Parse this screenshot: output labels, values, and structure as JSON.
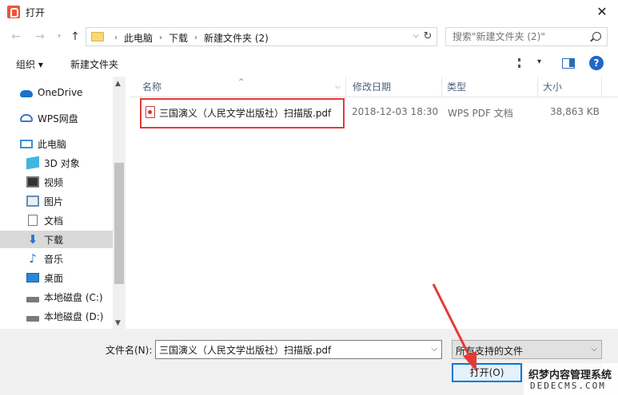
{
  "window": {
    "title": "打开",
    "close_glyph": "✕"
  },
  "address": {
    "crumbs": [
      "此电脑",
      "下载",
      "新建文件夹 (2)"
    ],
    "search_placeholder": "搜索\"新建文件夹 (2)\""
  },
  "toolbar": {
    "organize": "组织 ▾",
    "new_folder": "新建文件夹"
  },
  "nav": {
    "items": [
      {
        "label": "OneDrive",
        "icon": "cloud-icon"
      },
      {
        "label": "WPS网盘",
        "icon": "wps-cloud-icon"
      },
      {
        "label": "此电脑",
        "icon": "computer-icon"
      },
      {
        "label": "3D 对象",
        "icon": "3d-objects-icon"
      },
      {
        "label": "视频",
        "icon": "video-icon"
      },
      {
        "label": "图片",
        "icon": "pictures-icon"
      },
      {
        "label": "文档",
        "icon": "documents-icon"
      },
      {
        "label": "下载",
        "icon": "download-icon",
        "selected": true
      },
      {
        "label": "音乐",
        "icon": "music-icon"
      },
      {
        "label": "桌面",
        "icon": "desktop-icon"
      },
      {
        "label": "本地磁盘 (C:)",
        "icon": "drive-icon"
      },
      {
        "label": "本地磁盘 (D:)",
        "icon": "drive-icon"
      }
    ]
  },
  "columns": {
    "name": "名称",
    "date": "修改日期",
    "type": "类型",
    "size": "大小"
  },
  "files": [
    {
      "name": "三国演义（人民文学出版社）扫描版.pdf",
      "date": "2018-12-03 18:30",
      "type": "WPS PDF 文档",
      "size": "38,863 KB",
      "icon": "pdf-icon"
    }
  ],
  "footer": {
    "filename_label": "文件名(N):",
    "filename_value": "三国演义（人民文学出版社）扫描版.pdf",
    "filetype": "所有支持的文件",
    "open_button": "打开(O)"
  },
  "watermark": {
    "line1": "织梦内容管理系统",
    "line2": "DEDECMS.COM"
  },
  "colors": {
    "accent": "#0078d7",
    "highlight": "#e53935",
    "selected_bg": "#d9d9d9"
  }
}
